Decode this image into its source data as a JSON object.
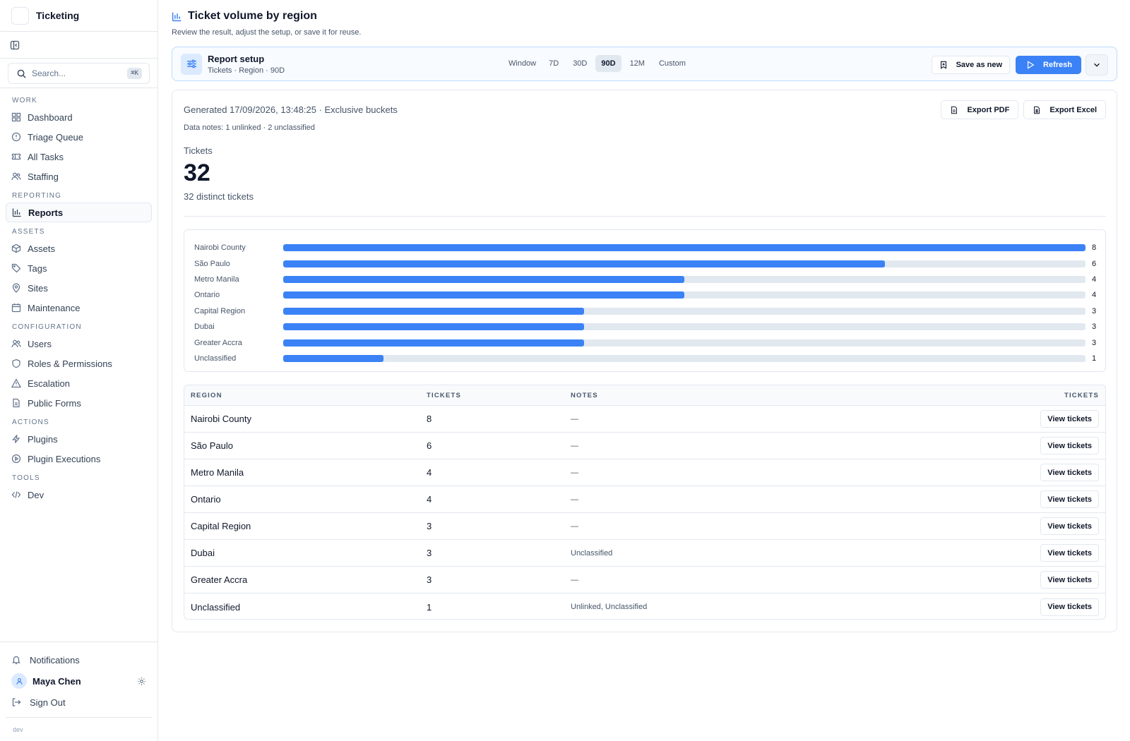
{
  "app": {
    "name": "Ticketing"
  },
  "search": {
    "placeholder": "Search...",
    "shortcut": "⌘K"
  },
  "nav": [
    {
      "section": "WORK",
      "items": [
        {
          "label": "Dashboard",
          "icon": "dashboard-icon"
        },
        {
          "label": "Triage Queue",
          "icon": "alert-circle-icon"
        },
        {
          "label": "All Tasks",
          "icon": "ticket-icon"
        },
        {
          "label": "Staffing",
          "icon": "users-icon"
        }
      ]
    },
    {
      "section": "REPORTING",
      "items": [
        {
          "label": "Reports",
          "icon": "bar-chart-icon",
          "active": true
        }
      ]
    },
    {
      "section": "ASSETS",
      "items": [
        {
          "label": "Assets",
          "icon": "box-icon"
        },
        {
          "label": "Tags",
          "icon": "tag-icon"
        },
        {
          "label": "Sites",
          "icon": "map-pin-icon"
        },
        {
          "label": "Maintenance",
          "icon": "calendar-icon"
        }
      ]
    },
    {
      "section": "CONFIGURATION",
      "items": [
        {
          "label": "Users",
          "icon": "users-icon"
        },
        {
          "label": "Roles & Permissions",
          "icon": "shield-icon"
        },
        {
          "label": "Escalation",
          "icon": "warning-icon"
        },
        {
          "label": "Public Forms",
          "icon": "document-icon"
        }
      ]
    },
    {
      "section": "ACTIONS",
      "items": [
        {
          "label": "Plugins",
          "icon": "lightning-icon"
        },
        {
          "label": "Plugin Executions",
          "icon": "play-circle-icon"
        }
      ]
    },
    {
      "section": "TOOLS",
      "items": [
        {
          "label": "Dev",
          "icon": "code-icon"
        }
      ]
    }
  ],
  "sidebar_bottom": {
    "notifications": "Notifications",
    "user_name": "Maya Chen",
    "sign_out": "Sign Out",
    "env": "dev"
  },
  "page": {
    "title": "Ticket volume by region",
    "subtitle": "Review the result, adjust the setup, or save it for reuse."
  },
  "setup": {
    "title": "Report setup",
    "summary": "Tickets · Region · 90D",
    "window_label": "Window",
    "windows": [
      "7D",
      "30D",
      "90D",
      "12M",
      "Custom"
    ],
    "active_window": "90D",
    "save_label": "Save as new",
    "refresh_label": "Refresh"
  },
  "report": {
    "generated": "Generated 17/09/2026, 13:48:25 · Exclusive buckets",
    "data_notes": "Data notes: 1 unlinked · 2 unclassified",
    "export_pdf": "Export PDF",
    "export_excel": "Export Excel",
    "kpi_label": "Tickets",
    "kpi_value": "32",
    "kpi_sub": "32 distinct tickets"
  },
  "colors": {
    "accent": "#3b82f6",
    "track": "#e2e8f0"
  },
  "chart_data": {
    "type": "bar",
    "orientation": "horizontal",
    "categories": [
      "Nairobi County",
      "São Paulo",
      "Metro Manila",
      "Ontario",
      "Capital Region",
      "Dubai",
      "Greater Accra",
      "Unclassified"
    ],
    "values": [
      8,
      6,
      4,
      4,
      3,
      3,
      3,
      1
    ],
    "xlim": [
      0,
      8
    ],
    "title": "",
    "xlabel": "",
    "ylabel": ""
  },
  "table": {
    "headers": {
      "region": "REGION",
      "tickets": "TICKETS",
      "notes": "NOTES",
      "action": "TICKETS"
    },
    "rows": [
      {
        "region": "Nairobi County",
        "tickets": "8",
        "notes": "—",
        "action": "View tickets"
      },
      {
        "region": "São Paulo",
        "tickets": "6",
        "notes": "—",
        "action": "View tickets"
      },
      {
        "region": "Metro Manila",
        "tickets": "4",
        "notes": "—",
        "action": "View tickets"
      },
      {
        "region": "Ontario",
        "tickets": "4",
        "notes": "—",
        "action": "View tickets"
      },
      {
        "region": "Capital Region",
        "tickets": "3",
        "notes": "—",
        "action": "View tickets"
      },
      {
        "region": "Dubai",
        "tickets": "3",
        "notes": "Unclassified",
        "action": "View tickets"
      },
      {
        "region": "Greater Accra",
        "tickets": "3",
        "notes": "—",
        "action": "View tickets"
      },
      {
        "region": "Unclassified",
        "tickets": "1",
        "notes": "Unlinked, Unclassified",
        "action": "View tickets"
      }
    ]
  }
}
